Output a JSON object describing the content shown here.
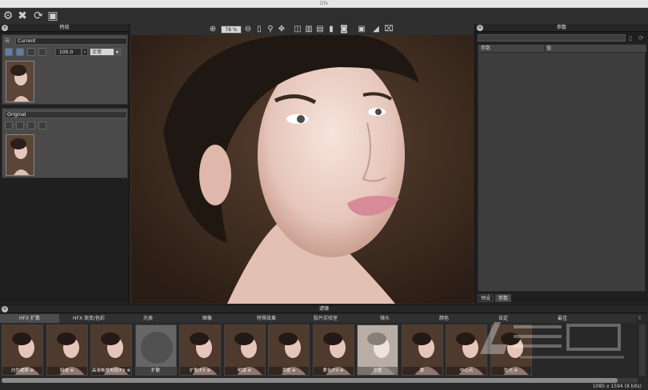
{
  "window": {
    "title": "Dfx"
  },
  "left_panel": {
    "title": "特效",
    "current_layer": {
      "name": "Current",
      "opacity": "100.0",
      "blend_mode": "正常"
    },
    "original_layer": {
      "name": "Original"
    }
  },
  "preview": {
    "zoom": "78 %"
  },
  "right_panel": {
    "title": "参数",
    "col_param": "参数",
    "col_value": "值",
    "tabs": [
      "预设",
      "参数"
    ]
  },
  "filters": {
    "title": "滤镜",
    "categories": [
      "HFX 扩散",
      "HFX 渐变/色彩",
      "光类",
      "图像",
      "特殊效果",
      "胶片实验室",
      "镜头",
      "颜色",
      "自定",
      "最佳"
    ],
    "tiles": [
      "白色耀眼 ⊗",
      "焖烧 ⊗",
      "高清晰度电视/FX ⊗",
      "扩散",
      "扩散/FX ⊗",
      "明镜 ⊗",
      "漂雾 ⊗",
      "柔化/FX ⊗",
      "双重",
      "雾",
      "中心点",
      "弦光 ⊗"
    ],
    "status": "1085 x 1594 (8 bits)"
  },
  "colors": {
    "accent": "#5b7fa8",
    "panel": "#1f1f1f",
    "skin": "#e8c7bd",
    "background": "#3b2a20"
  }
}
